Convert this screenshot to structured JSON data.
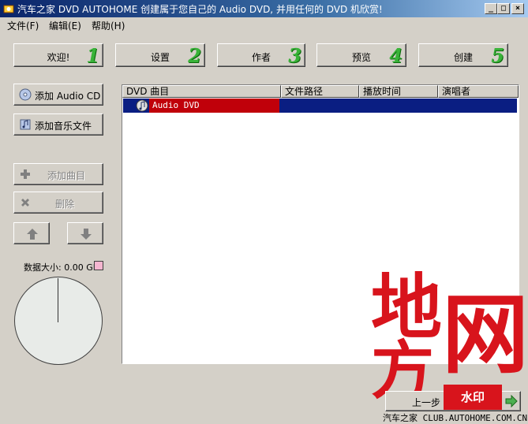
{
  "window": {
    "title": "汽车之家 DVD AUTOHOME 创建属于您自己的 Audio DVD, 并用任何的 DVD 机欣赏!",
    "minimize": "_",
    "maximize": "□",
    "close": "×"
  },
  "menu": [
    "文件(F)",
    "编辑(E)",
    "帮助(H)"
  ],
  "steps": [
    {
      "label": "欢迎!",
      "num": "1"
    },
    {
      "label": "设置",
      "num": "2"
    },
    {
      "label": "作者",
      "num": "3"
    },
    {
      "label": "预览",
      "num": "4"
    },
    {
      "label": "创建",
      "num": "5"
    }
  ],
  "side": {
    "add_audio_cd": "添加 Audio CD",
    "add_music_file": "添加音乐文件",
    "add_track": "添加曲目",
    "delete": "删除",
    "data_size": "数据大小: 0.00 GB"
  },
  "list": {
    "columns": [
      "DVD 曲目",
      "文件路径",
      "播放时间",
      "演唱者"
    ],
    "rows": [
      {
        "name": "Audio DVD"
      }
    ]
  },
  "footer": {
    "prev": "上一步",
    "site": "汽车之家 CLUB.AUTOHOME.COM.CN",
    "stamp": "水印"
  },
  "watermark": {
    "c1": "地",
    "c2": "方",
    "c3": "网"
  },
  "colors": {
    "step_number": "#39b339",
    "selection": "#0a1e82",
    "row_highlight": "#c0000a",
    "watermark": "#d8141c"
  }
}
